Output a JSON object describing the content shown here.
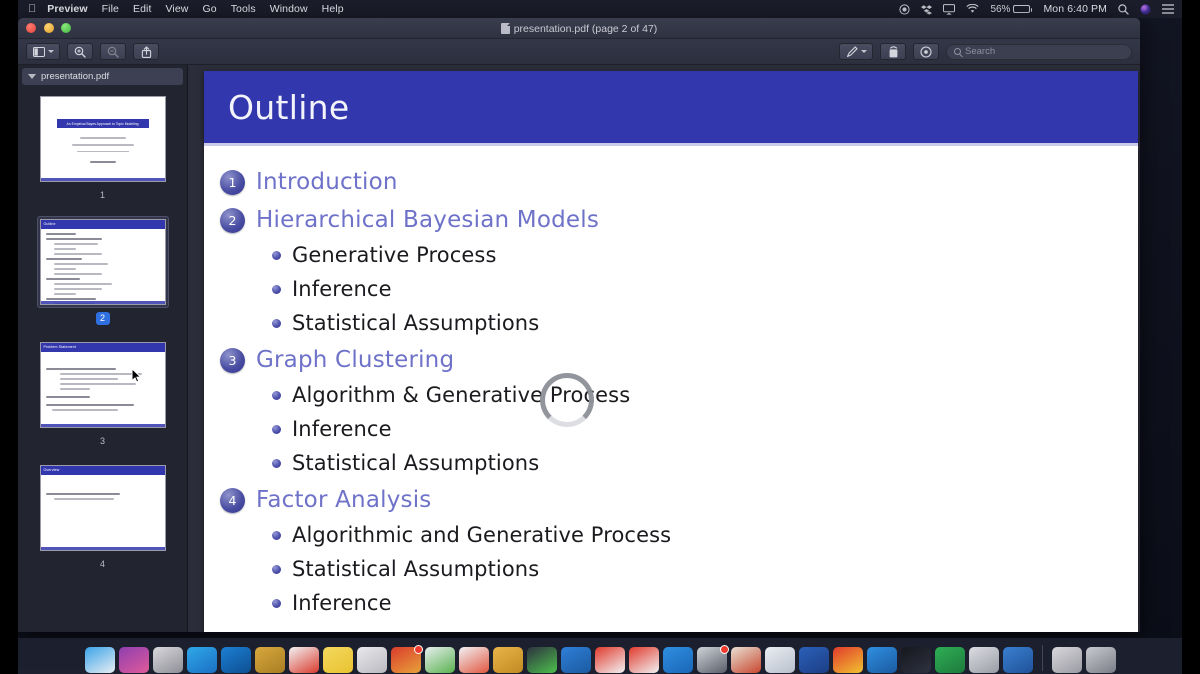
{
  "menubar": {
    "apple_icon": "apple-logo-icon",
    "items": [
      "Preview",
      "File",
      "Edit",
      "View",
      "Go",
      "Tools",
      "Window",
      "Help"
    ],
    "status_icons": [
      "screen-record-icon",
      "dropbox-icon",
      "airplay-icon",
      "wifi-icon"
    ],
    "battery_percent": "56%",
    "clock": "Mon 6:40 PM",
    "right_icons": [
      "search-icon",
      "siri-icon",
      "control-center-icon"
    ]
  },
  "window": {
    "title": "presentation.pdf (page 2 of 47)",
    "traffic_lights": [
      "close",
      "minimize",
      "zoom"
    ]
  },
  "toolbar": {
    "sidebar_label": "Sidebar",
    "zoom_in_label": "Zoom In",
    "zoom_out_label": "Zoom Out",
    "share_label": "Share",
    "markup_label": "Markup",
    "rotate_label": "Rotate",
    "annotate_label": "Annotate",
    "search_placeholder": "Search"
  },
  "sidebar": {
    "header": "presentation.pdf",
    "thumbnails": [
      {
        "page": "1",
        "title": "An Empirical Bayes Approach to Topic Modeling",
        "selected": false,
        "layout": "title"
      },
      {
        "page": "2",
        "title": "Outline",
        "selected": true,
        "layout": "outline"
      },
      {
        "page": "3",
        "title": "Problem Statement",
        "selected": false,
        "layout": "bullets"
      },
      {
        "page": "4",
        "title": "Overview",
        "selected": false,
        "layout": "bullets"
      }
    ]
  },
  "slide": {
    "title": "Outline",
    "sections": [
      {
        "number": "1",
        "title": "Introduction",
        "items": []
      },
      {
        "number": "2",
        "title": "Hierarchical Bayesian Models",
        "items": [
          "Generative Process",
          "Inference",
          "Statistical Assumptions"
        ]
      },
      {
        "number": "3",
        "title": "Graph Clustering",
        "items": [
          "Algorithm & Generative Process",
          "Inference",
          "Statistical Assumptions"
        ]
      },
      {
        "number": "4",
        "title": "Factor Analysis",
        "items": [
          "Algorithmic and Generative Process",
          "Statistical Assumptions",
          "Inference"
        ]
      }
    ],
    "colors": {
      "header_blue": "#3237ad",
      "section_title": "#6e72c8",
      "body_text": "#1b1b1f",
      "page_background": "#ffffff"
    },
    "loading_spinner": "visible"
  },
  "dock": {
    "items": [
      {
        "name": "finder",
        "color1": "#3aa3e8",
        "color2": "#e9eef3",
        "badge": false
      },
      {
        "name": "siri",
        "color1": "#8e3fb0",
        "color2": "#e05a9a",
        "badge": false
      },
      {
        "name": "launchpad",
        "color1": "#d8d8dc",
        "color2": "#8e8e96",
        "badge": false
      },
      {
        "name": "safari",
        "color1": "#2fa8e8",
        "color2": "#1b6fc4",
        "badge": false
      },
      {
        "name": "itunes",
        "color1": "#1d7fd3",
        "color2": "#0d4f92",
        "badge": false
      },
      {
        "name": "folder",
        "color1": "#d8a83f",
        "color2": "#a87e22",
        "badge": false
      },
      {
        "name": "mail",
        "color1": "#f2f2f4",
        "color2": "#d93b2c",
        "badge": false
      },
      {
        "name": "notes",
        "color1": "#f4d85e",
        "color2": "#e8c230",
        "badge": false
      },
      {
        "name": "pages",
        "color1": "#e9e9ec",
        "color2": "#b9b9c0",
        "badge": false
      },
      {
        "name": "maps",
        "color1": "#d93b2c",
        "color2": "#e8a33a",
        "badge": true
      },
      {
        "name": "numbers",
        "color1": "#e8eef0",
        "color2": "#59b24d",
        "badge": false
      },
      {
        "name": "photos",
        "color1": "#f2f2f4",
        "color2": "#e0563f",
        "badge": false
      },
      {
        "name": "files",
        "color1": "#e8b54a",
        "color2": "#c28a22",
        "badge": false
      },
      {
        "name": "activity-monitor",
        "color1": "#2e3140",
        "color2": "#4cc04c",
        "badge": false
      },
      {
        "name": "keynote",
        "color1": "#2f7fd8",
        "color2": "#1b5aa0",
        "badge": false
      },
      {
        "name": "blocker",
        "color1": "#e03a2c",
        "color2": "#f2f2f4",
        "badge": false
      },
      {
        "name": "blocker-alt",
        "color1": "#e03a2c",
        "color2": "#f2f2f4",
        "badge": false
      },
      {
        "name": "appstore",
        "color1": "#2f8fe0",
        "color2": "#1a66b8",
        "badge": false
      },
      {
        "name": "disk-utility",
        "color1": "#cfd2d8",
        "color2": "#5a5f6a",
        "badge": true
      },
      {
        "name": "news",
        "color1": "#e8e0d2",
        "color2": "#c8462f",
        "badge": false
      },
      {
        "name": "weather",
        "color1": "#e9edf2",
        "color2": "#b8c0cc",
        "badge": false
      },
      {
        "name": "word",
        "color1": "#2b5fb8",
        "color2": "#1c3f85",
        "badge": false
      },
      {
        "name": "chrome",
        "color1": "#e03a2c",
        "color2": "#f2c230",
        "badge": false
      },
      {
        "name": "sketch",
        "color1": "#2f8fe0",
        "color2": "#1b5aa0",
        "badge": false
      },
      {
        "name": "terminal",
        "color1": "#16181e",
        "color2": "#2e3140",
        "badge": false
      },
      {
        "name": "excel",
        "color1": "#2fae55",
        "color2": "#1d7a3c",
        "badge": false
      },
      {
        "name": "preview",
        "color1": "#dcdde2",
        "color2": "#9a9ca6",
        "badge": false
      },
      {
        "name": "system-preferences",
        "color1": "#3a7fd0",
        "color2": "#1f5299",
        "badge": false
      }
    ],
    "trailing_items": [
      {
        "name": "downloads-stack",
        "color1": "#d8d8dc",
        "color2": "#9a9aa2",
        "badge": false
      },
      {
        "name": "trash",
        "color1": "#c8cad0",
        "color2": "#7a7d86",
        "badge": false
      }
    ]
  }
}
